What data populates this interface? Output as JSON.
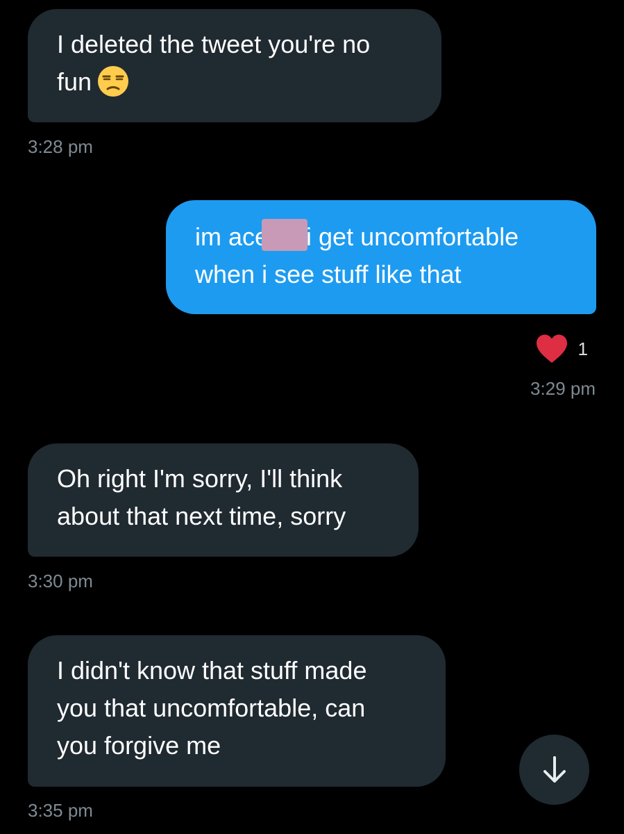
{
  "messages": [
    {
      "direction": "received",
      "lines": [
        "I deleted the tweet you're no",
        "fun"
      ],
      "emoji": "unamused-face-emoji",
      "time": "3:28 pm"
    },
    {
      "direction": "sent",
      "lines": [
        "im ace",
        "i get uncomfortable",
        "when i see stuff like that"
      ],
      "redaction_color": "#c99ab8",
      "reaction": {
        "icon": "heart-icon",
        "color": "#dd2e44",
        "count": "1"
      },
      "time": "3:29 pm"
    },
    {
      "direction": "received",
      "lines": [
        "Oh right I'm sorry, I'll think",
        "about that next time, sorry"
      ],
      "time": "3:30 pm"
    },
    {
      "direction": "received",
      "lines": [
        "I didn't know that stuff made",
        "you that uncomfortable, can",
        "you forgive me"
      ],
      "time": "3:35 pm"
    }
  ],
  "scroll_button": {
    "icon": "arrow-down-icon"
  },
  "colors": {
    "background": "#000000",
    "received_bubble": "#202a31",
    "sent_bubble": "#1d9bf0",
    "timestamp": "#7f8a93"
  }
}
